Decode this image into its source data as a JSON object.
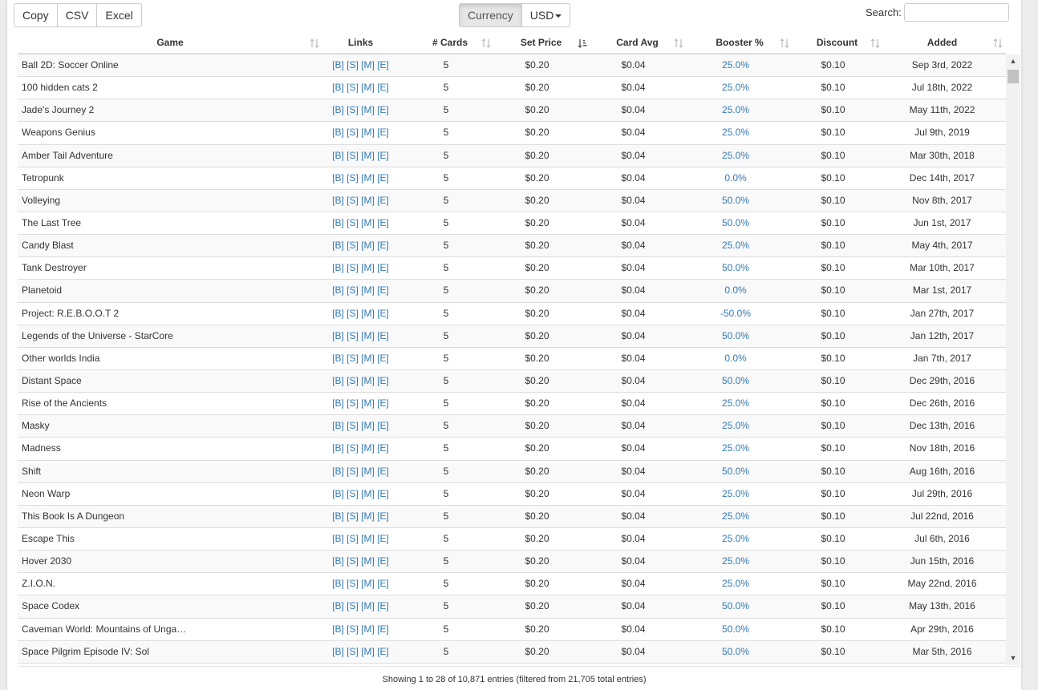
{
  "toolbar": {
    "export_buttons": [
      "Copy",
      "CSV",
      "Excel"
    ],
    "currency_label": "Currency",
    "currency_value": "USD"
  },
  "search": {
    "label": "Search:",
    "value": ""
  },
  "columns": [
    "Game",
    "Links",
    "# Cards",
    "Set Price",
    "Card Avg",
    "Booster %",
    "Discount",
    "Added"
  ],
  "link_labels": [
    "[B]",
    "[S]",
    "[M]",
    "[E]"
  ],
  "rows": [
    {
      "game": "Ball 2D: Soccer Online",
      "cards": "5",
      "price": "$0.20",
      "avg": "$0.04",
      "booster": "25.0%",
      "discount": "$0.10",
      "added": "Sep 3rd, 2022"
    },
    {
      "game": "100 hidden cats 2",
      "cards": "5",
      "price": "$0.20",
      "avg": "$0.04",
      "booster": "25.0%",
      "discount": "$0.10",
      "added": "Jul 18th, 2022"
    },
    {
      "game": "Jade's Journey 2",
      "cards": "5",
      "price": "$0.20",
      "avg": "$0.04",
      "booster": "25.0%",
      "discount": "$0.10",
      "added": "May 11th, 2022"
    },
    {
      "game": "Weapons Genius",
      "cards": "5",
      "price": "$0.20",
      "avg": "$0.04",
      "booster": "25.0%",
      "discount": "$0.10",
      "added": "Jul 9th, 2019"
    },
    {
      "game": "Amber Tail Adventure",
      "cards": "5",
      "price": "$0.20",
      "avg": "$0.04",
      "booster": "25.0%",
      "discount": "$0.10",
      "added": "Mar 30th, 2018"
    },
    {
      "game": "Tetropunk",
      "cards": "5",
      "price": "$0.20",
      "avg": "$0.04",
      "booster": "0.0%",
      "discount": "$0.10",
      "added": "Dec 14th, 2017"
    },
    {
      "game": "Volleying",
      "cards": "5",
      "price": "$0.20",
      "avg": "$0.04",
      "booster": "50.0%",
      "discount": "$0.10",
      "added": "Nov 8th, 2017"
    },
    {
      "game": "The Last Tree",
      "cards": "5",
      "price": "$0.20",
      "avg": "$0.04",
      "booster": "50.0%",
      "discount": "$0.10",
      "added": "Jun 1st, 2017"
    },
    {
      "game": "Candy Blast",
      "cards": "5",
      "price": "$0.20",
      "avg": "$0.04",
      "booster": "25.0%",
      "discount": "$0.10",
      "added": "May 4th, 2017"
    },
    {
      "game": "Tank Destroyer",
      "cards": "5",
      "price": "$0.20",
      "avg": "$0.04",
      "booster": "50.0%",
      "discount": "$0.10",
      "added": "Mar 10th, 2017"
    },
    {
      "game": "Planetoid",
      "cards": "5",
      "price": "$0.20",
      "avg": "$0.04",
      "booster": "0.0%",
      "discount": "$0.10",
      "added": "Mar 1st, 2017"
    },
    {
      "game": "Project: R.E.B.O.O.T 2",
      "cards": "5",
      "price": "$0.20",
      "avg": "$0.04",
      "booster": "-50.0%",
      "discount": "$0.10",
      "added": "Jan 27th, 2017"
    },
    {
      "game": "Legends of the Universe - StarCore",
      "cards": "5",
      "price": "$0.20",
      "avg": "$0.04",
      "booster": "50.0%",
      "discount": "$0.10",
      "added": "Jan 12th, 2017"
    },
    {
      "game": "Other worlds India",
      "cards": "5",
      "price": "$0.20",
      "avg": "$0.04",
      "booster": "0.0%",
      "discount": "$0.10",
      "added": "Jan 7th, 2017"
    },
    {
      "game": "Distant Space",
      "cards": "5",
      "price": "$0.20",
      "avg": "$0.04",
      "booster": "50.0%",
      "discount": "$0.10",
      "added": "Dec 29th, 2016"
    },
    {
      "game": "Rise of the Ancients",
      "cards": "5",
      "price": "$0.20",
      "avg": "$0.04",
      "booster": "25.0%",
      "discount": "$0.10",
      "added": "Dec 26th, 2016"
    },
    {
      "game": "Masky",
      "cards": "5",
      "price": "$0.20",
      "avg": "$0.04",
      "booster": "25.0%",
      "discount": "$0.10",
      "added": "Dec 13th, 2016"
    },
    {
      "game": "Madness",
      "cards": "5",
      "price": "$0.20",
      "avg": "$0.04",
      "booster": "25.0%",
      "discount": "$0.10",
      "added": "Nov 18th, 2016"
    },
    {
      "game": "Shift",
      "cards": "5",
      "price": "$0.20",
      "avg": "$0.04",
      "booster": "50.0%",
      "discount": "$0.10",
      "added": "Aug 16th, 2016"
    },
    {
      "game": "Neon Warp",
      "cards": "5",
      "price": "$0.20",
      "avg": "$0.04",
      "booster": "25.0%",
      "discount": "$0.10",
      "added": "Jul 29th, 2016"
    },
    {
      "game": "This Book Is A Dungeon",
      "cards": "5",
      "price": "$0.20",
      "avg": "$0.04",
      "booster": "25.0%",
      "discount": "$0.10",
      "added": "Jul 22nd, 2016"
    },
    {
      "game": "Escape This",
      "cards": "5",
      "price": "$0.20",
      "avg": "$0.04",
      "booster": "25.0%",
      "discount": "$0.10",
      "added": "Jul 6th, 2016"
    },
    {
      "game": "Hover 2030",
      "cards": "5",
      "price": "$0.20",
      "avg": "$0.04",
      "booster": "25.0%",
      "discount": "$0.10",
      "added": "Jun 15th, 2016"
    },
    {
      "game": "Z.I.O.N.",
      "cards": "5",
      "price": "$0.20",
      "avg": "$0.04",
      "booster": "25.0%",
      "discount": "$0.10",
      "added": "May 22nd, 2016"
    },
    {
      "game": "Space Codex",
      "cards": "5",
      "price": "$0.20",
      "avg": "$0.04",
      "booster": "50.0%",
      "discount": "$0.10",
      "added": "May 13th, 2016"
    },
    {
      "game": "Caveman World: Mountains of Unga…",
      "cards": "5",
      "price": "$0.20",
      "avg": "$0.04",
      "booster": "50.0%",
      "discount": "$0.10",
      "added": "Apr 29th, 2016"
    },
    {
      "game": "Space Pilgrim Episode IV: Sol",
      "cards": "5",
      "price": "$0.20",
      "avg": "$0.04",
      "booster": "50.0%",
      "discount": "$0.10",
      "added": "Mar 5th, 2016"
    }
  ],
  "footer": {
    "info": "Showing 1 to 28 of 10,871 entries (filtered from 21,705 total entries)"
  }
}
